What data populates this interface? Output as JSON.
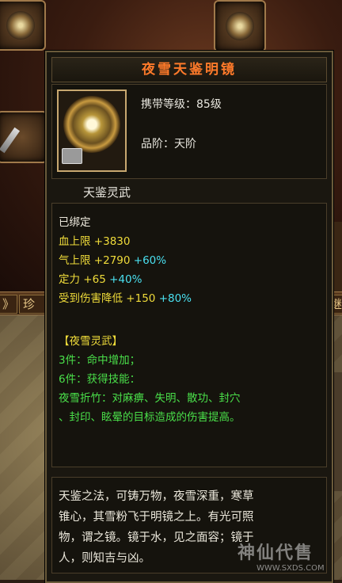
{
  "item": {
    "name": "夜雪天鉴明镜",
    "carry_level": "携带等级：85级",
    "grade": "品阶：天阶",
    "attribute_type": "天鉴灵武"
  },
  "stats": {
    "bound": "已绑定",
    "lines": [
      {
        "label": "血上限",
        "base": "+3830",
        "bonus": ""
      },
      {
        "label": "气上限",
        "base": "+2790",
        "bonus": "+60%"
      },
      {
        "label": "定力",
        "base": "+65",
        "bonus": "+40%"
      },
      {
        "label": "受到伤害降低",
        "base": "+150",
        "bonus": "+80%"
      }
    ],
    "set_name": "【夜雪灵武】",
    "set_3": "3件：命中增加；",
    "set_6": "6件：获得技能：",
    "skill_line1": "夜雪折竹：对麻痹、失明、散功、封穴",
    "skill_line2": "、封印、眩晕的目标造成的伤害提高。"
  },
  "description": [
    "天鉴之法，可铸万物，夜雪深重，寒草",
    "锥心，其雪粉飞于明镜之上。有光可照",
    "物，谓之镜。镜于水，见之面容；镜于",
    "人，则知吉与凶。"
  ],
  "background": {
    "tab_left": "》",
    "tab_zhen": "珍",
    "tab_right": "继"
  },
  "watermark": {
    "text": "神仙代售",
    "url": "WWW.SXDS.COM"
  },
  "colors": {
    "title": "#ff7a2a",
    "yellow": "#f0dc3a",
    "cyan": "#4ae0f0",
    "green": "#4ae04a"
  }
}
